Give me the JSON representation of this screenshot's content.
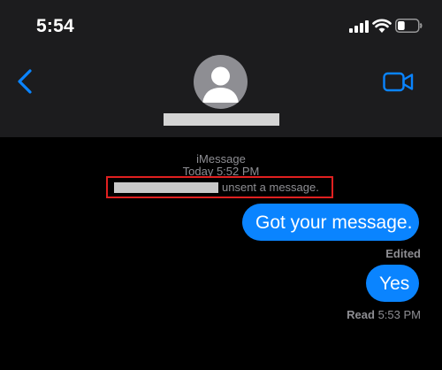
{
  "status_bar": {
    "time": "5:54",
    "battery_level": 0.35
  },
  "header": {
    "back_icon": "chevron-left-icon",
    "avatar_icon": "person-silhouette-icon",
    "video_icon": "video-camera-icon"
  },
  "thread": {
    "service": "iMessage",
    "timestamp": "Today 5:52 PM",
    "unsent_notice": "unsent a message.",
    "messages": [
      {
        "text": "Got your message.",
        "status": "Edited"
      },
      {
        "text": "Yes"
      }
    ],
    "receipt": {
      "label": "Read",
      "time": "5:53 PM"
    }
  },
  "colors": {
    "bubble": "#0a84ff",
    "accent": "#0a84ff",
    "highlight_box": "#e02020",
    "header_bg": "#1c1c1e"
  }
}
